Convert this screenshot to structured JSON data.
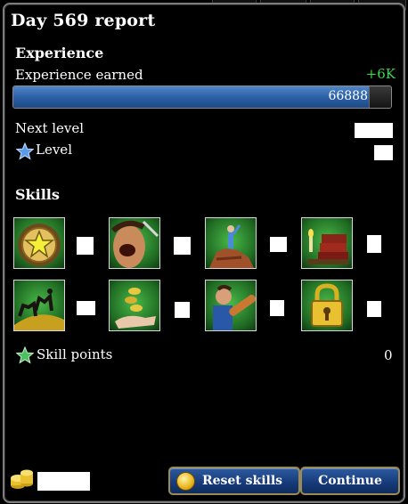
{
  "header": {
    "title": "Day 569 report"
  },
  "experience": {
    "section_label": "Experience",
    "earned_label": "Experience earned",
    "earned_gain": "+6K",
    "bar_value": "66888",
    "bar_fill_fraction": 1.0,
    "next_level_label": "Next level",
    "level_label": "Level"
  },
  "skills": {
    "section_label": "Skills",
    "items": [
      {
        "icon": "star-medal-icon"
      },
      {
        "icon": "shouting-face-icon"
      },
      {
        "icon": "explorer-on-rock-icon"
      },
      {
        "icon": "books-candle-icon"
      },
      {
        "icon": "camel-caravan-icon"
      },
      {
        "icon": "coins-in-hand-icon"
      },
      {
        "icon": "worker-carrying-log-icon"
      },
      {
        "icon": "golden-padlock-icon"
      }
    ],
    "points_label": "Skill points",
    "points_value": "0"
  },
  "footer": {
    "reset_label": "Reset skills",
    "continue_label": "Continue"
  },
  "colors": {
    "xp_gain": "#3bd84a",
    "button_blue": "#2c5aa0",
    "panel_border": "#7d7d7d"
  }
}
